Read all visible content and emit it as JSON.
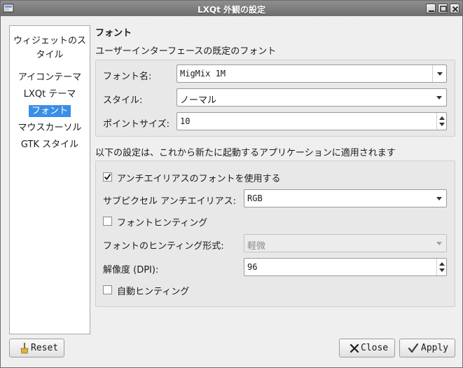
{
  "window": {
    "title": "LXQt 外観の設定"
  },
  "sidebar": {
    "items": [
      {
        "label": "ウィジェットのスタイル",
        "selected": false
      },
      {
        "label": "アイコンテーマ",
        "selected": false
      },
      {
        "label": "LXQt テーマ",
        "selected": false
      },
      {
        "label": "フォント",
        "selected": true
      },
      {
        "label": "マウスカーソル",
        "selected": false
      },
      {
        "label": "GTK スタイル",
        "selected": false
      }
    ]
  },
  "page": {
    "heading": "フォント",
    "default_font_section": "ユーザーインターフェースの既定のフォント",
    "font_name": {
      "label": "フォント名:",
      "value": "MigMix 1M"
    },
    "style": {
      "label": "スタイル:",
      "value": "ノーマル"
    },
    "point_size": {
      "label": "ポイントサイズ:",
      "value": "10"
    },
    "app_section": "以下の設定は、これから新たに起動するアプリケーションに適用されます",
    "antialias": {
      "label": "アンチエイリアスのフォントを使用する",
      "checked": true
    },
    "subpixel": {
      "label": "サブピクセル アンチエイリアス:",
      "value": "RGB"
    },
    "hinting": {
      "label": "フォントヒンティング",
      "checked": false
    },
    "hint_style": {
      "label": "フォントのヒンティング形式:",
      "value": "軽微",
      "enabled": false
    },
    "dpi": {
      "label": "解像度 (DPI):",
      "value": "96"
    },
    "autohint": {
      "label": "自動ヒンティング",
      "checked": false
    }
  },
  "buttons": {
    "reset": "Reset",
    "close": "Close",
    "apply": "Apply"
  },
  "colors": {
    "selection": "#3a8ee6",
    "titlebar": "#7d7d7d",
    "accent_check": "#3a9a2a",
    "close_x": "#1a1a1a"
  },
  "icons": {
    "app": "lxqt-appearance-icon",
    "reset": "broom-icon",
    "close": "x-icon",
    "apply": "checkmark-icon"
  }
}
